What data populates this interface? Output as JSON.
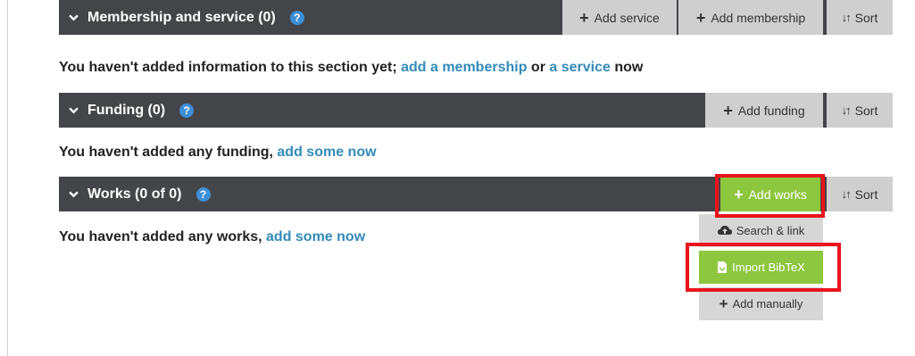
{
  "membership": {
    "title": "Membership and service (0)",
    "help": "?",
    "add_service": "Add service",
    "add_membership": "Add membership",
    "sort": "Sort",
    "empty_prefix": "You haven't added information to this section yet; ",
    "link_membership": "add a membership",
    "or": " or ",
    "link_service": "a service",
    "now": " now"
  },
  "funding": {
    "title": "Funding (0)",
    "help": "?",
    "add_funding": "Add funding",
    "sort": "Sort",
    "empty_prefix": "You haven't added any funding, ",
    "link": "add some now"
  },
  "works": {
    "title": "Works (0 of 0)",
    "help": "?",
    "add_works": "Add works",
    "sort": "Sort",
    "empty_prefix": "You haven't added any works, ",
    "link": "add some now",
    "dropdown": {
      "search_link": "Search & link",
      "import_bibtex": "Import BibTeX",
      "add_manually": "Add manually"
    }
  },
  "colors": {
    "bar": "#444549",
    "button": "#cfcfcf",
    "accent_green": "#8dc63f",
    "link": "#338bb8",
    "highlight": "#e8141c"
  }
}
